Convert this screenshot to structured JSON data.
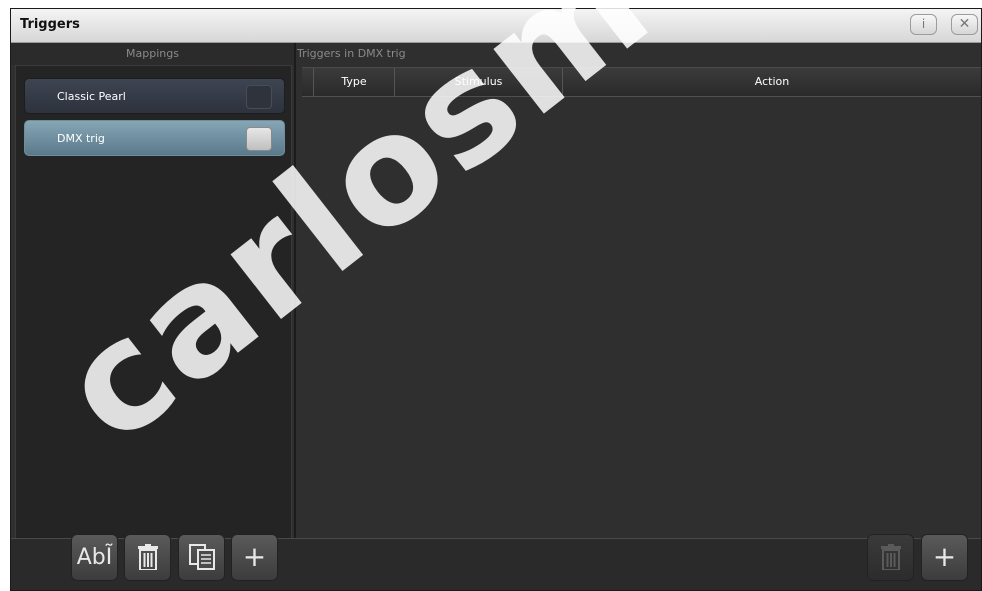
{
  "window": {
    "title": "Triggers"
  },
  "titlebar": {
    "info_label": "i",
    "close_label": "✕"
  },
  "mappings": {
    "header": "Mappings",
    "items": [
      {
        "label": "Classic Pearl",
        "selected": false
      },
      {
        "label": "DMX trig",
        "selected": true
      }
    ]
  },
  "triggers": {
    "header": "Triggers in DMX trig",
    "columns": [
      "Type",
      "Stimulus",
      "Action"
    ],
    "rows": []
  },
  "toolbar": {
    "rename_label": "Ab",
    "add_label": "+",
    "trigger_add_label": "+",
    "icons": [
      "rename-icon",
      "trash-icon",
      "copy-icon",
      "plus-icon",
      "trash-icon",
      "plus-icon"
    ]
  },
  "watermark": {
    "text": "carlosmendoz"
  },
  "colors": {
    "selected_item": "#6f8fa0",
    "background": "#2f2f2f",
    "titlebar": "#e4e4e4"
  }
}
